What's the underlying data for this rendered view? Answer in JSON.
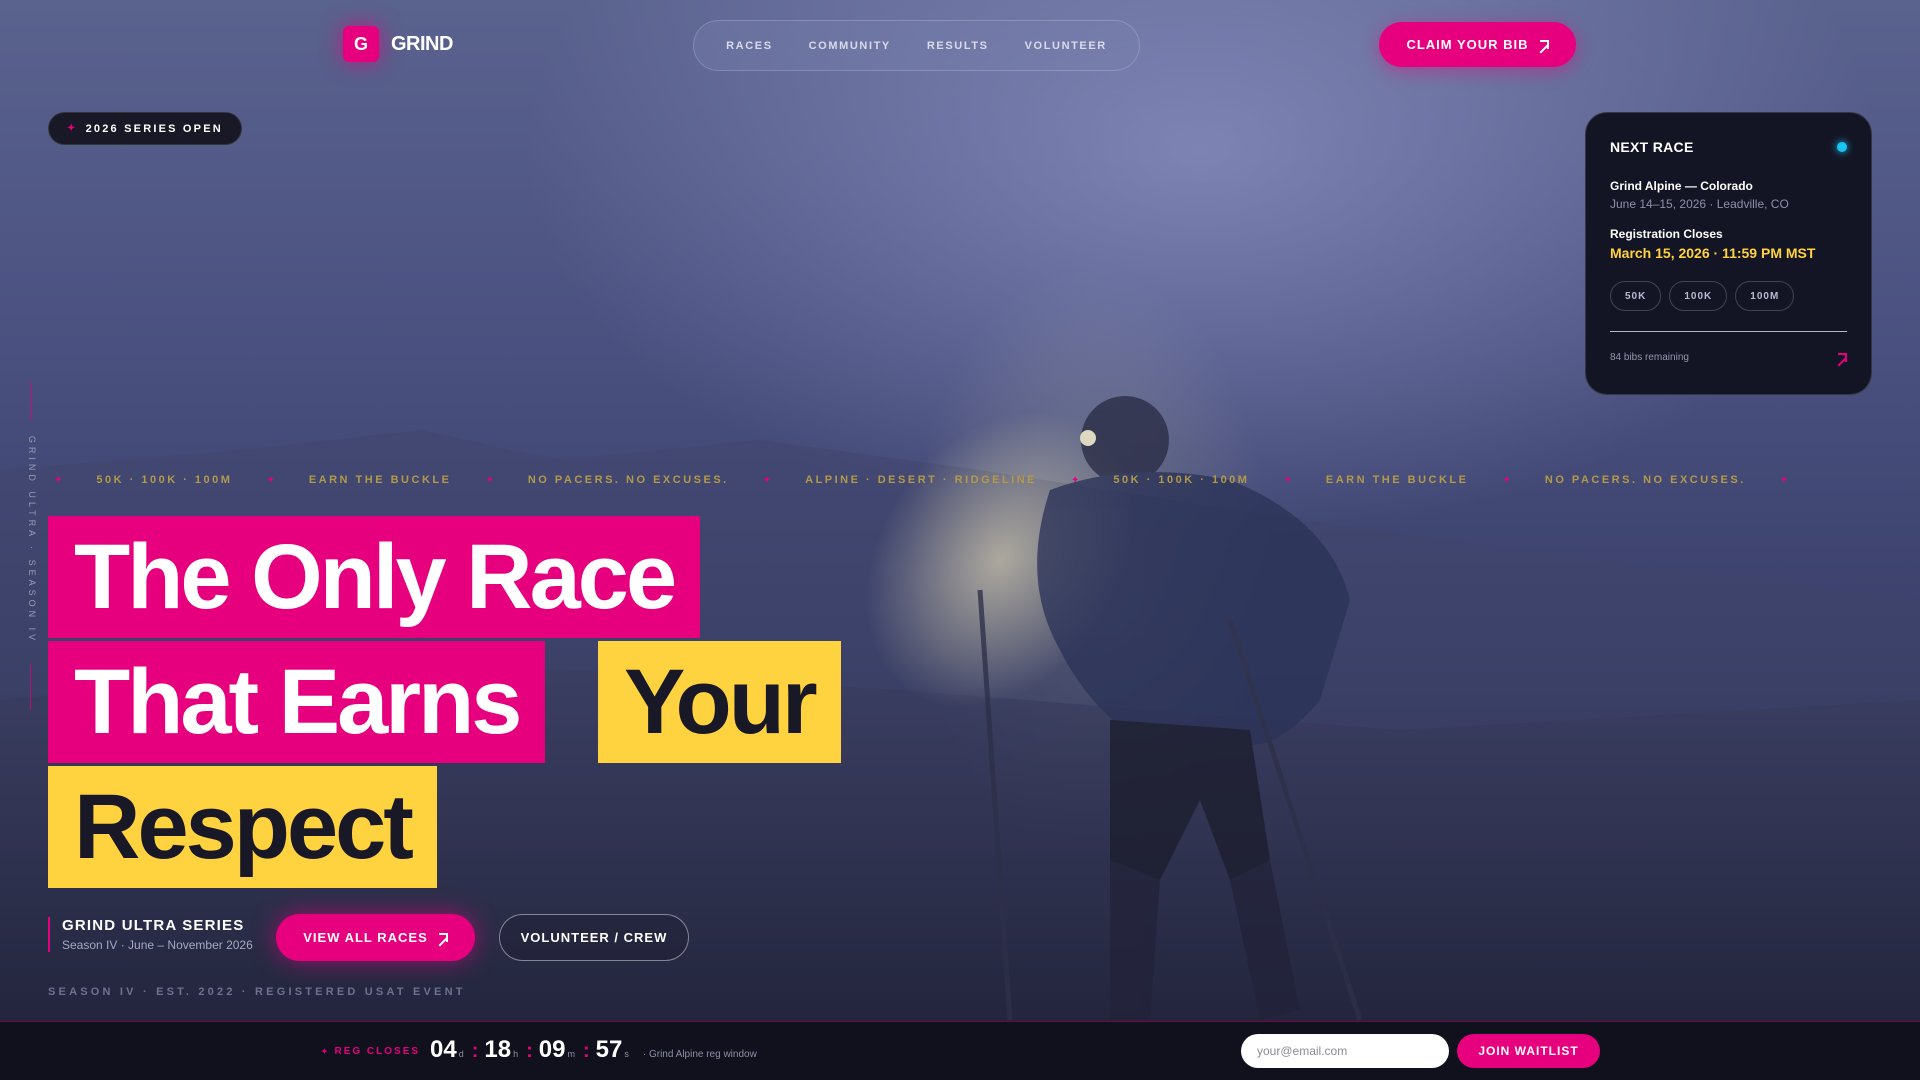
{
  "brand": {
    "mark": "G",
    "name": "GRIND"
  },
  "nav": {
    "items": [
      "RACES",
      "COMMUNITY",
      "RESULTS",
      "VOLUNTEER"
    ]
  },
  "header_cta": "CLAIM YOUR BIB",
  "series_badge": "2026 SERIES OPEN",
  "next_race": {
    "title": "NEXT RACE",
    "race_name": "Grind Alpine — Colorado",
    "race_date": "June 14–15, 2026 · Leadville, CO",
    "reg_label": "Registration Closes",
    "reg_date": "March 15, 2026 · 11:59 PM MST",
    "distances": [
      "50K",
      "100K",
      "100M"
    ],
    "bibs_remaining": "84 bibs remaining"
  },
  "vertical_label": "GRIND ULTRA · SEASON IV",
  "ticker": [
    "50K · 100K · 100M",
    "EARN THE BUCKLE",
    "NO PACERS. NO EXCUSES.",
    "ALPINE · DESERT · RIDGELINE",
    "50K · 100K · 100M",
    "EARN THE BUCKLE",
    "NO PACERS. NO EXCUSES."
  ],
  "headline": {
    "line1": "The Only Race",
    "line2a": "That Earns",
    "line2b": "Your",
    "line3": "Respect"
  },
  "series_info": {
    "name": "GRIND ULTRA SERIES",
    "sub": "Season IV · June – November 2026"
  },
  "buttons": {
    "primary": "VIEW ALL RACES",
    "secondary": "VOLUNTEER / CREW"
  },
  "est_line": "SEASON IV · EST. 2022 · REGISTERED USAT EVENT",
  "bottom_bar": {
    "reg_closes": "REG CLOSES",
    "countdown": {
      "days": "04",
      "hours": "18",
      "minutes": "09",
      "seconds": "57",
      "d": "d",
      "h": "h",
      "m": "m",
      "s": "s"
    },
    "note": "· Grind Alpine reg window",
    "email_placeholder": "your@email.com",
    "join": "JOIN WAITLIST"
  },
  "colors": {
    "accent": "#e6007e",
    "highlight": "#ffd23f",
    "live": "#18c4f2",
    "dark": "#141524"
  }
}
